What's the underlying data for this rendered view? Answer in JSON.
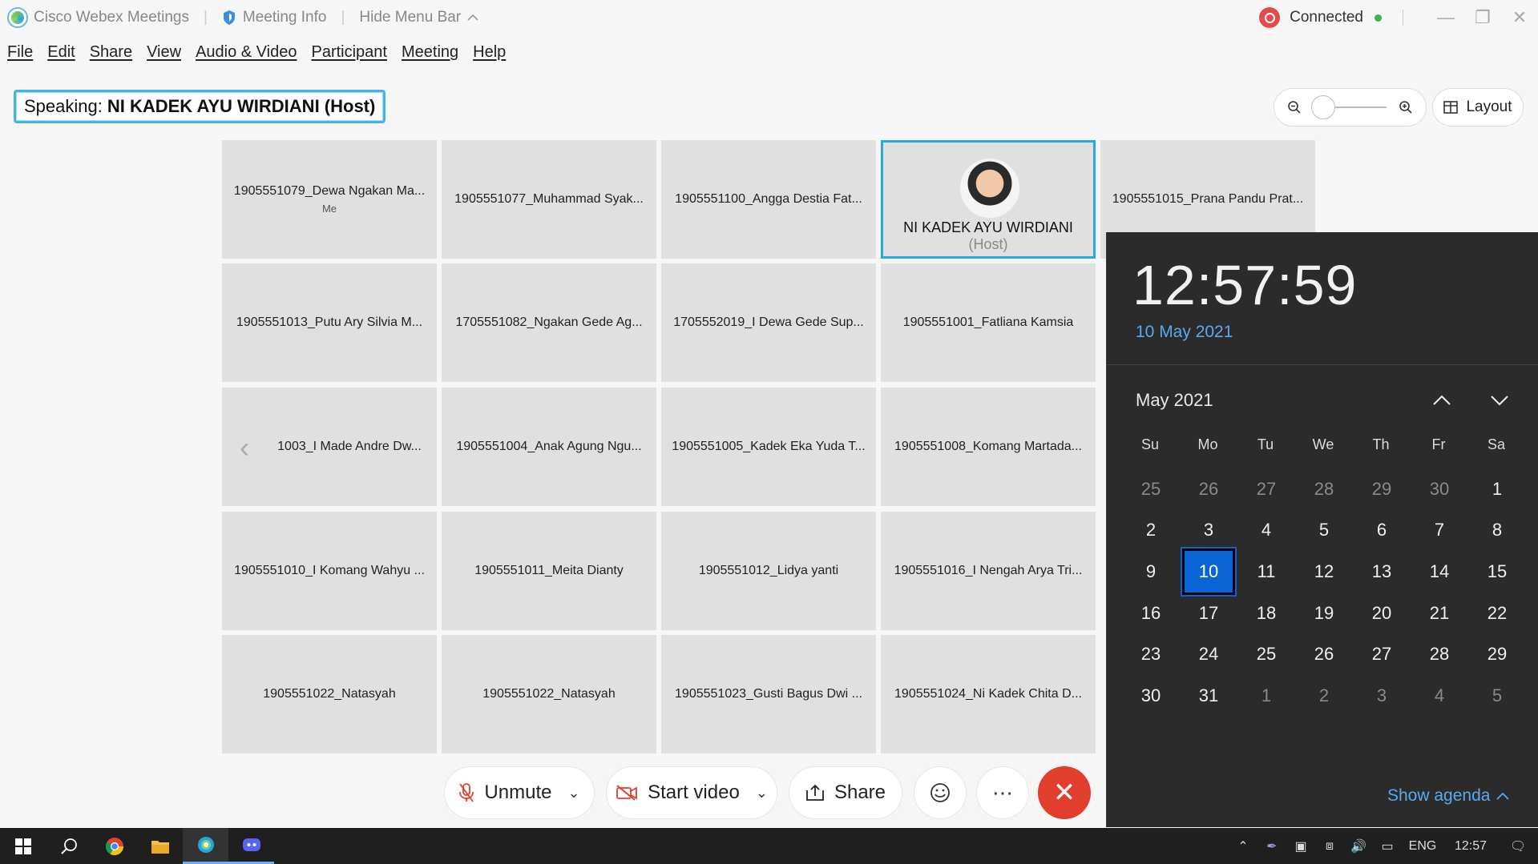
{
  "titlebar": {
    "app_name": "Cisco Webex Meetings",
    "meeting_info": "Meeting Info",
    "hide_menu": "Hide Menu Bar",
    "status": "Connected",
    "status_color": "#3bb54a"
  },
  "menu": [
    "File",
    "Edit",
    "Share",
    "View",
    "Audio & Video",
    "Participant",
    "Meeting",
    "Help"
  ],
  "speaking": {
    "prefix": "Speaking:",
    "name": "NI KADEK AYU WIRDIANI (Host)"
  },
  "layout_label": "Layout",
  "participants": [
    {
      "name": "1905551079_Dewa Ngakan Ma...",
      "sub": "Me"
    },
    {
      "name": "1905551077_Muhammad Syak..."
    },
    {
      "name": "1905551100_Angga Destia Fat..."
    },
    {
      "name": "NI KADEK AYU WIRDIANI",
      "host_suffix": "(Host)",
      "active": true
    },
    {
      "name": "1905551015_Prana Pandu Prat..."
    },
    {
      "name": "1905551013_Putu Ary Silvia M..."
    },
    {
      "name": "1705551082_Ngakan Gede Ag..."
    },
    {
      "name": "1705552019_I Dewa Gede Sup..."
    },
    {
      "name": "1905551001_Fatliana Kamsia"
    },
    {
      "name": "1003_I Made Andre Dw..."
    },
    {
      "name": "1905551004_Anak Agung Ngu..."
    },
    {
      "name": "1905551005_Kadek Eka Yuda T..."
    },
    {
      "name": "1905551008_Komang Martada..."
    },
    {
      "name": "1905551010_I Komang Wahyu ..."
    },
    {
      "name": "1905551011_Meita Dianty"
    },
    {
      "name": "1905551012_Lidya yanti"
    },
    {
      "name": "1905551016_I Nengah Arya Tri..."
    },
    {
      "name": "1905551022_Natasyah"
    },
    {
      "name": "1905551022_Natasyah"
    },
    {
      "name": "1905551023_Gusti Bagus Dwi ..."
    },
    {
      "name": "1905551024_Ni Kadek Chita D..."
    }
  ],
  "controls": {
    "unmute": "Unmute",
    "start_video": "Start video",
    "share": "Share"
  },
  "calendar": {
    "time": "12:57:59",
    "date": "10 May 2021",
    "month": "May 2021",
    "weekdays": [
      "Su",
      "Mo",
      "Tu",
      "We",
      "Th",
      "Fr",
      "Sa"
    ],
    "days": [
      [
        "25",
        "26",
        "27",
        "28",
        "29",
        "30",
        "1"
      ],
      [
        "2",
        "3",
        "4",
        "5",
        "6",
        "7",
        "8"
      ],
      [
        "9",
        "10",
        "11",
        "12",
        "13",
        "14",
        "15"
      ],
      [
        "16",
        "17",
        "18",
        "19",
        "20",
        "21",
        "22"
      ],
      [
        "23",
        "24",
        "25",
        "26",
        "27",
        "28",
        "29"
      ],
      [
        "30",
        "31",
        "1",
        "2",
        "3",
        "4",
        "5"
      ]
    ],
    "today": "10",
    "show_agenda": "Show agenda",
    "accent": "#0a64d6"
  },
  "taskbar": {
    "lang": "ENG",
    "clock": "12:57"
  }
}
